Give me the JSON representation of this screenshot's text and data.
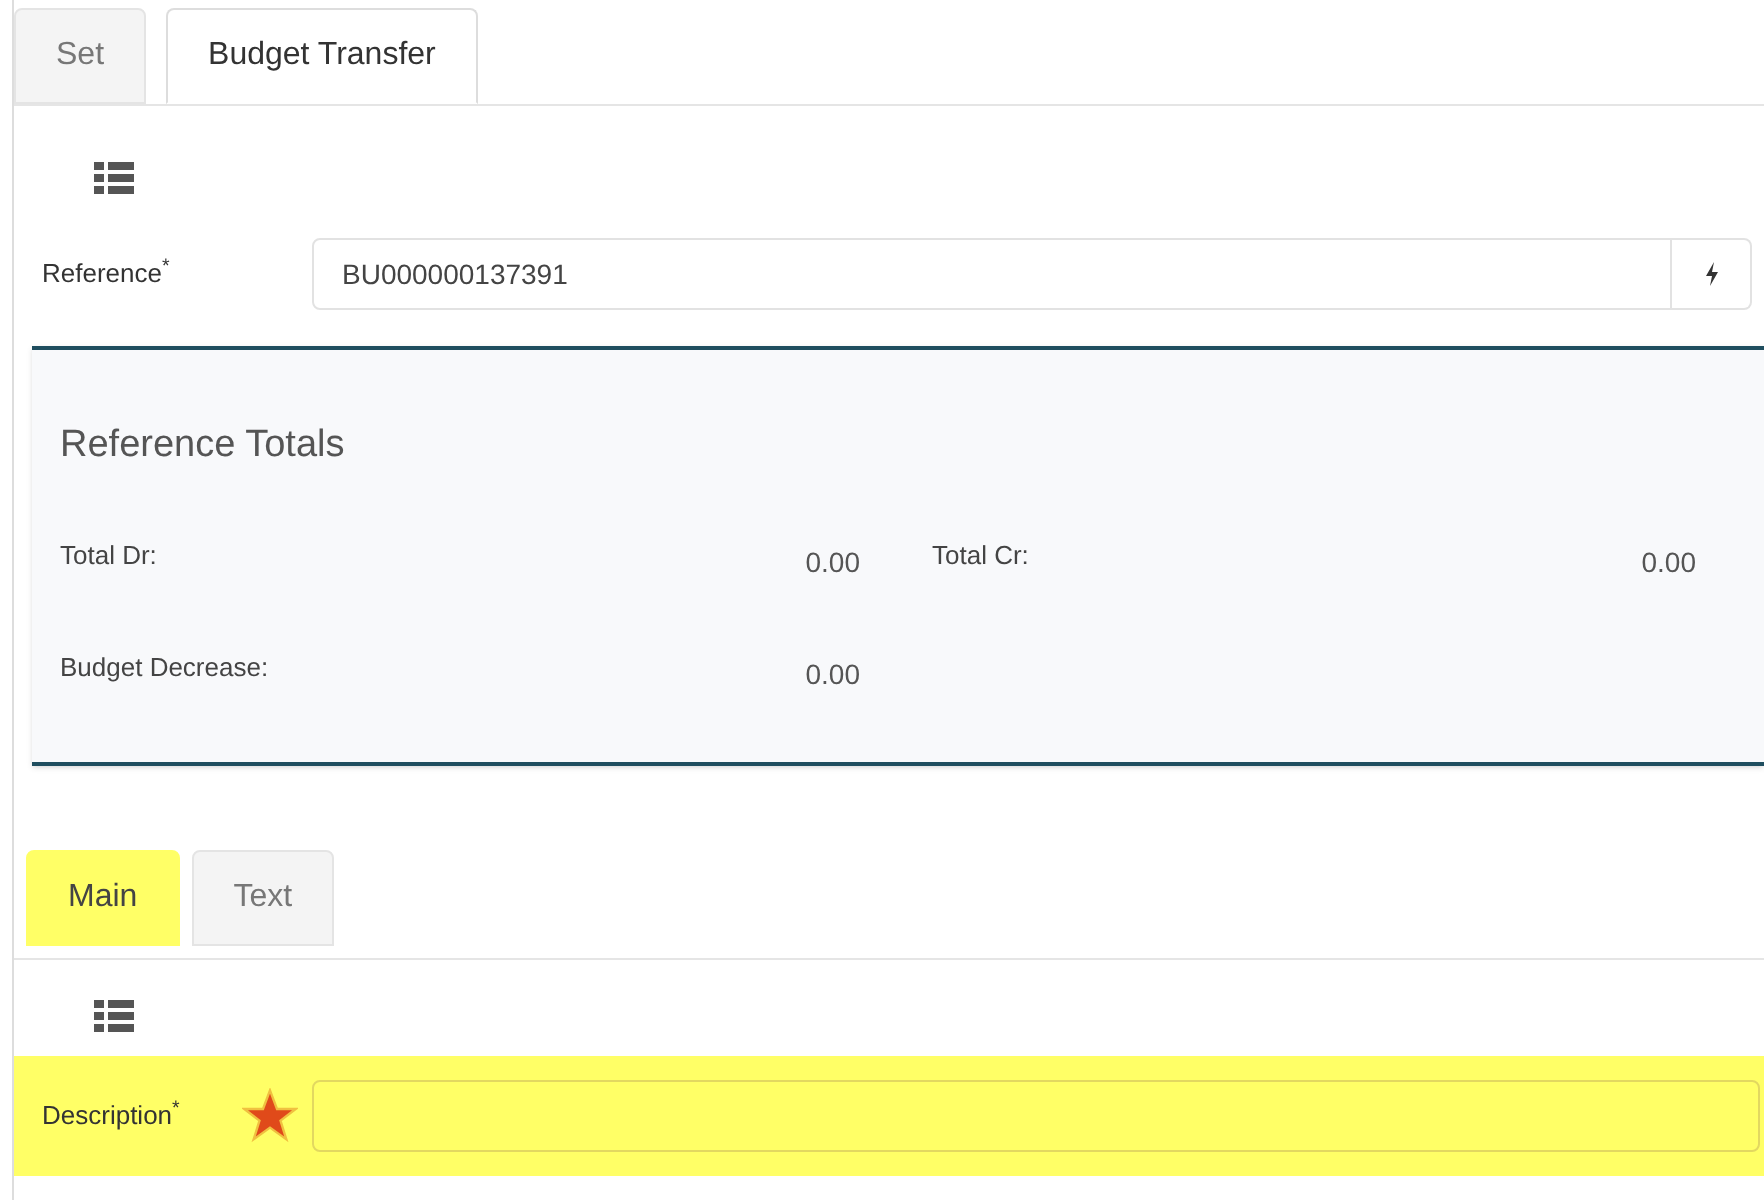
{
  "tabs": [
    {
      "label": "Set",
      "selected": false
    },
    {
      "label": "Budget Transfer",
      "selected": true
    }
  ],
  "reference": {
    "label": "Reference$^{*}$",
    "value": "BU000000137391"
  },
  "totals": {
    "title": "Reference Totals",
    "items": [
      {
        "label": "Total Dr:",
        "value": "0.00"
      },
      {
        "label": "Total Cr:",
        "value": "0.00"
      },
      {
        "label": "Budget Decrease:",
        "value": "0.00"
      }
    ]
  },
  "sub_tabs": [
    {
      "label": "Main",
      "selected": true,
      "highlighted": true
    },
    {
      "label": "Text",
      "selected": false,
      "highlighted": false
    }
  ],
  "description": {
    "label": "Description$^{*}$",
    "highlighted": true
  }
}
